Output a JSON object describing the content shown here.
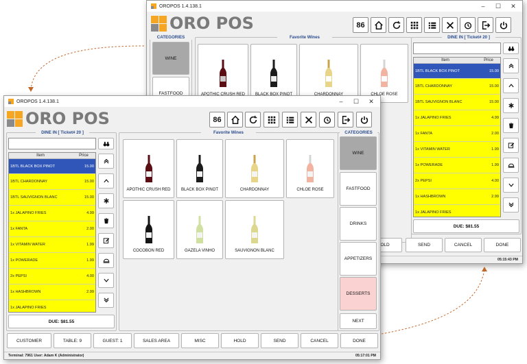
{
  "app": {
    "title": "OROPOS 1.4.138.1",
    "logo_text": "ORO POS",
    "colors": {
      "ticket_yellow": "#ffff00",
      "selected_row": "#2f56b8",
      "panel_title": "#2a4b8d",
      "desserts_pink": "#fbd2d2",
      "selected_category": "#a8a8a8"
    }
  },
  "toolbar": {
    "counter": "86",
    "icons": [
      "home-icon",
      "refresh-icon",
      "grid-icon",
      "list-icon",
      "tools-icon",
      "history-icon",
      "logout-icon",
      "power-icon"
    ]
  },
  "ticket": {
    "title": "DINE IN [ Ticket# 20 ]",
    "col_item": "Item",
    "col_price": "Price",
    "rows": [
      {
        "name": "1BTL BLACK BOX PINOT",
        "price": "15.00",
        "selected": true
      },
      {
        "name": "1BTL CHARDONNAY",
        "price": "15.00"
      },
      {
        "name": "1BTL SAUVIGNON BLANC",
        "price": "15.00"
      },
      {
        "name": "1x JALAPINO FRIES",
        "price": "4.99"
      },
      {
        "name": "1x FANTA",
        "price": "2.00"
      },
      {
        "name": "1x VITAMIN WATER",
        "price": "1.99"
      },
      {
        "name": "1x POWERADE",
        "price": "1.99"
      },
      {
        "name": "2x PEPSI",
        "price": "4.00"
      },
      {
        "name": "1x HASHBROWN",
        "price": "2.99"
      },
      {
        "name": "1x JALAPINO FRIES",
        "price": ""
      }
    ],
    "due": "DUE: $81.55"
  },
  "favorites": {
    "title": "Favorite Wines",
    "items": [
      {
        "name": "APOTHIC CRUSH RED",
        "color": "#5a0d12"
      },
      {
        "name": "BLACK BOX PINOT",
        "color": "#1c1c1c"
      },
      {
        "name": "CHARDONNAY",
        "color": "#e8d58a"
      },
      {
        "name": "CHLOE ROSE",
        "color": "#f2b3a0"
      },
      {
        "name": "COCOBON RED",
        "color": "#151515"
      },
      {
        "name": "GAZELA VINHO",
        "color": "#cfe0a0"
      },
      {
        "name": "SAUVIGNON BLANC",
        "color": "#dcd890"
      }
    ]
  },
  "categories": {
    "title": "CATEGORIES",
    "items": [
      "WINE",
      "FASTFOOD",
      "DRINKS",
      "APPETIZERS",
      "DESSERTS"
    ],
    "next": "NEXT"
  },
  "bottom_bar": [
    "CUSTOMER",
    "TABLE: 9",
    "GUEST: 1",
    "SALES AREA",
    "MISC",
    "HOLD",
    "SEND",
    "CANCEL",
    "DONE"
  ],
  "back_bottom_bar": [
    "OLD",
    "SEND",
    "CANCEL",
    "DONE"
  ],
  "status": {
    "left": "Terminal: 7961  User: Adam K (Administrator)",
    "time_front": "05:17:01 PM",
    "time_back": "05:15:43 PM"
  }
}
